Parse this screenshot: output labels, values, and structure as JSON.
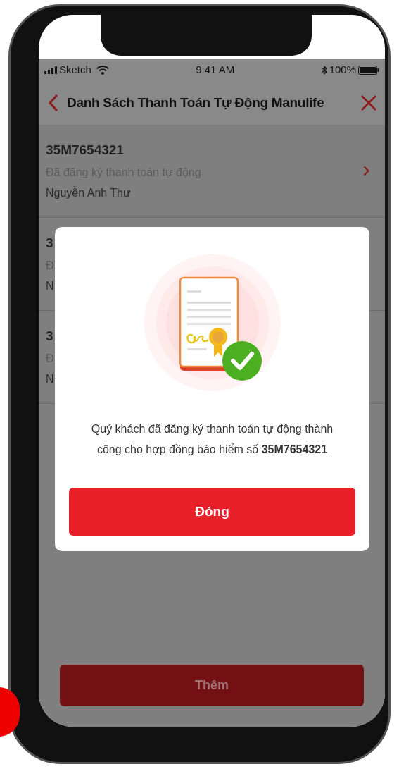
{
  "status_bar": {
    "carrier": "Sketch",
    "time": "9:41 AM",
    "battery": "100%"
  },
  "header": {
    "title": "Danh Sách Thanh Toán Tự Động Manulife"
  },
  "policies": [
    {
      "number": "35M7654321",
      "status": "Đã đăng ký thanh toán tự động",
      "holder": "Nguyễn Anh Thư"
    },
    {
      "number": "3",
      "status": "Đ",
      "holder": "N"
    },
    {
      "number": "3",
      "status": "Đ",
      "holder": "N"
    }
  ],
  "add_button": "Thêm",
  "dialog": {
    "message": "Quý khách đã đăng ký thanh toán tự động thành công cho hợp đồng bảo hiểm số **35M7654321**",
    "button": "Đóng"
  }
}
